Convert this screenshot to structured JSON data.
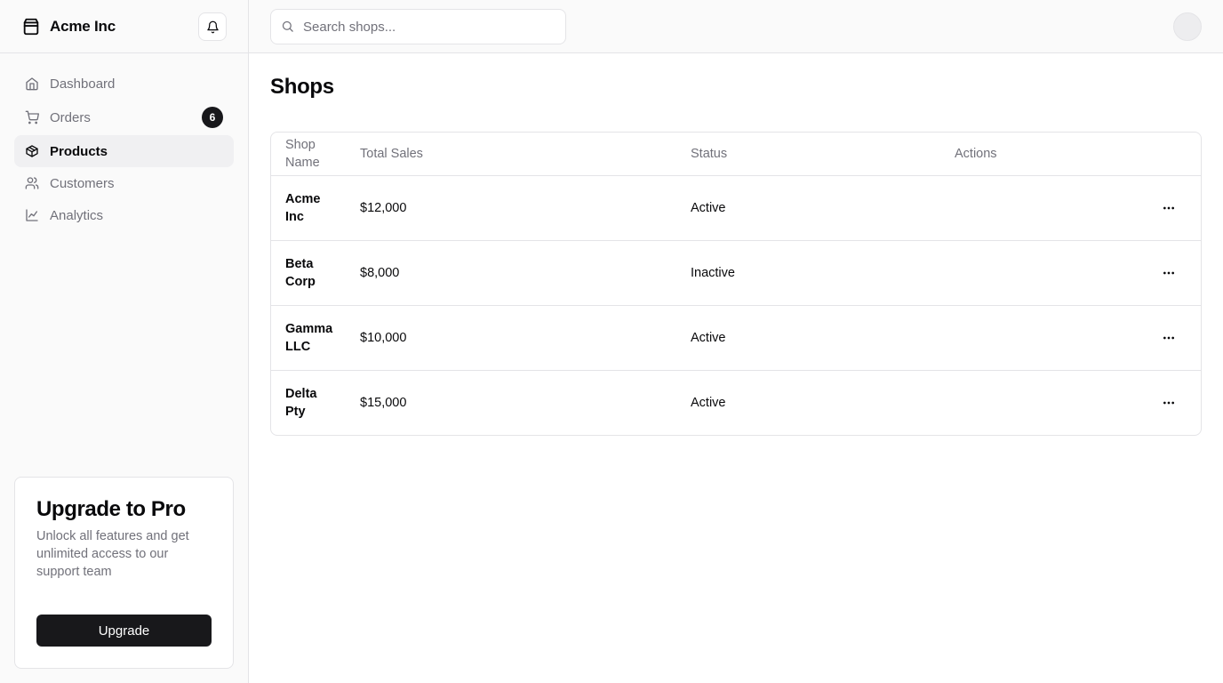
{
  "app": {
    "name": "Acme Inc"
  },
  "sidebar": {
    "items": [
      {
        "label": "Dashboard",
        "icon": "home-icon"
      },
      {
        "label": "Orders",
        "icon": "cart-icon",
        "badge": "6"
      },
      {
        "label": "Products",
        "icon": "package-icon",
        "active": true
      },
      {
        "label": "Customers",
        "icon": "users-icon"
      },
      {
        "label": "Analytics",
        "icon": "line-chart-icon"
      }
    ],
    "upgrade": {
      "title": "Upgrade to Pro",
      "description": "Unlock all features and get unlimited access to our support team",
      "button_label": "Upgrade"
    }
  },
  "search": {
    "placeholder": "Search shops..."
  },
  "main": {
    "title": "Shops",
    "table": {
      "headers": {
        "name": "Shop Name",
        "sales": "Total Sales",
        "status": "Status",
        "actions": "Actions"
      },
      "rows": [
        {
          "name": "Acme Inc",
          "sales": "$12,000",
          "status": "Active"
        },
        {
          "name": "Beta Corp",
          "sales": "$8,000",
          "status": "Inactive"
        },
        {
          "name": "Gamma LLC",
          "sales": "$10,000",
          "status": "Active"
        },
        {
          "name": "Delta Pty",
          "sales": "$15,000",
          "status": "Active"
        }
      ]
    }
  },
  "colors": {
    "accent": "#18181b",
    "muted_text": "#71717a",
    "border": "#e4e4e7",
    "sidebar_bg": "#fafafa"
  }
}
